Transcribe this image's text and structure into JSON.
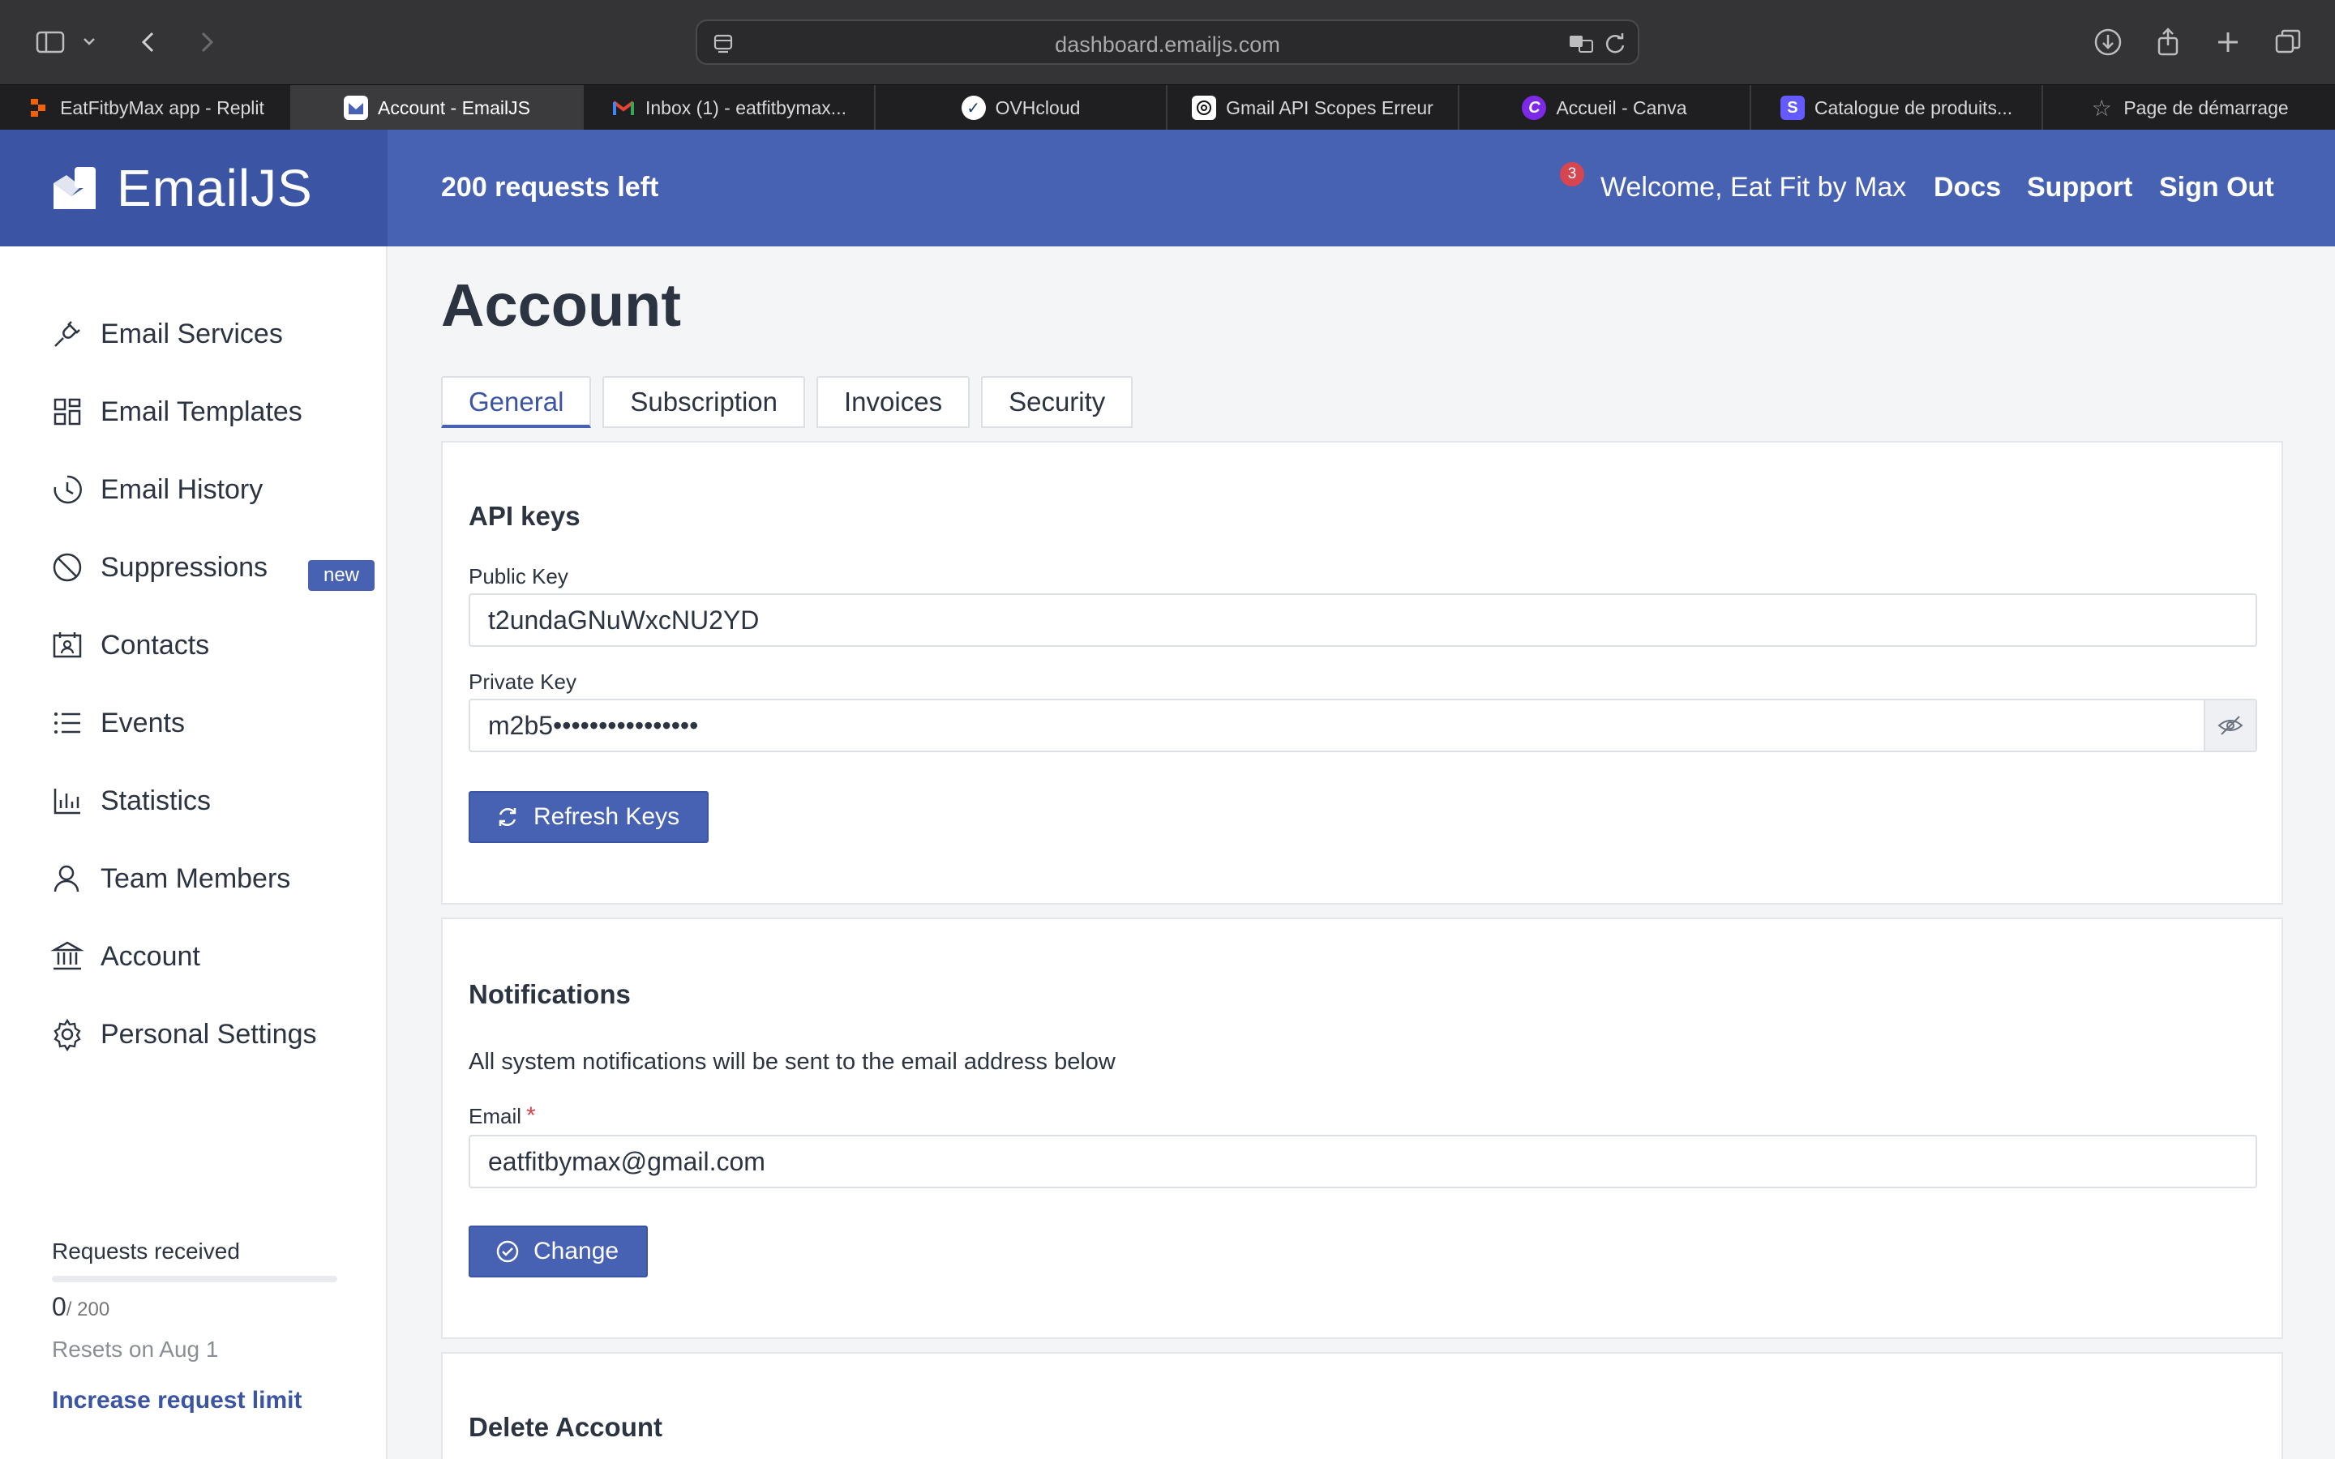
{
  "browser": {
    "url": "dashboard.emailjs.com",
    "tabs": [
      {
        "label": "EatFitbyMax app - Replit",
        "favicon": "replit-icon",
        "color": "#f26207"
      },
      {
        "label": "Account - EmailJS",
        "favicon": "emailjs-icon",
        "color": "#4762b3",
        "active": true
      },
      {
        "label": "Inbox (1) - eatfitbymax...",
        "favicon": "gmail-icon",
        "color": "#ea4335"
      },
      {
        "label": "OVHcloud",
        "favicon": "ovhcloud-icon",
        "color": "#123f6d"
      },
      {
        "label": "Gmail API Scopes Erreur",
        "favicon": "openai-icon",
        "color": "#ffffff"
      },
      {
        "label": "Accueil - Canva",
        "favicon": "canva-icon",
        "color": "#7d2ae8"
      },
      {
        "label": "Catalogue de produits...",
        "favicon": "stripe-icon",
        "color": "#635bff"
      },
      {
        "label": "Page de démarrage",
        "favicon": "star-icon",
        "color": "#9a9a9c"
      }
    ]
  },
  "header": {
    "brand": "EmailJS",
    "requests_left": "200 requests left",
    "notification_count": "3",
    "welcome": "Welcome,  Eat Fit by Max",
    "docs": "Docs",
    "support": "Support",
    "sign_out": "Sign Out"
  },
  "sidebar": {
    "items": [
      {
        "label": "Email Services",
        "icon": "plug-icon"
      },
      {
        "label": "Email Templates",
        "icon": "templates-icon"
      },
      {
        "label": "Email History",
        "icon": "history-icon"
      },
      {
        "label": "Suppressions",
        "icon": "block-icon",
        "badge": "new"
      },
      {
        "label": "Contacts",
        "icon": "contacts-icon"
      },
      {
        "label": "Events",
        "icon": "list-icon"
      },
      {
        "label": "Statistics",
        "icon": "chart-icon"
      },
      {
        "label": "Team Members",
        "icon": "user-icon"
      },
      {
        "label": "Account",
        "icon": "bank-icon"
      },
      {
        "label": "Personal Settings",
        "icon": "gear-icon"
      }
    ],
    "usage": {
      "label": "Requests received",
      "count": "0",
      "max": "/ 200",
      "progress_fraction": 0,
      "reset": "Resets on Aug 1",
      "increase_link": "Increase request limit"
    }
  },
  "main": {
    "title": "Account",
    "tabs": [
      "General",
      "Subscription",
      "Invoices",
      "Security"
    ],
    "active_tab": "General",
    "api_keys": {
      "heading": "API keys",
      "public_label": "Public Key",
      "public_value": "t2undaGNuWxcNU2YD",
      "private_label": "Private Key",
      "private_value": "m2b5••••••••••••••••",
      "refresh_button": "Refresh Keys"
    },
    "notifications": {
      "heading": "Notifications",
      "description": "All system notifications will be sent to the email address below",
      "email_label": "Email",
      "email_required": "*",
      "email_value": "eatfitbymax@gmail.com",
      "change_button": "Change"
    },
    "delete": {
      "heading": "Delete Account"
    }
  },
  "colors": {
    "primary": "#4762b3",
    "primary_dark": "#3b54a3",
    "required": "#d64550"
  }
}
